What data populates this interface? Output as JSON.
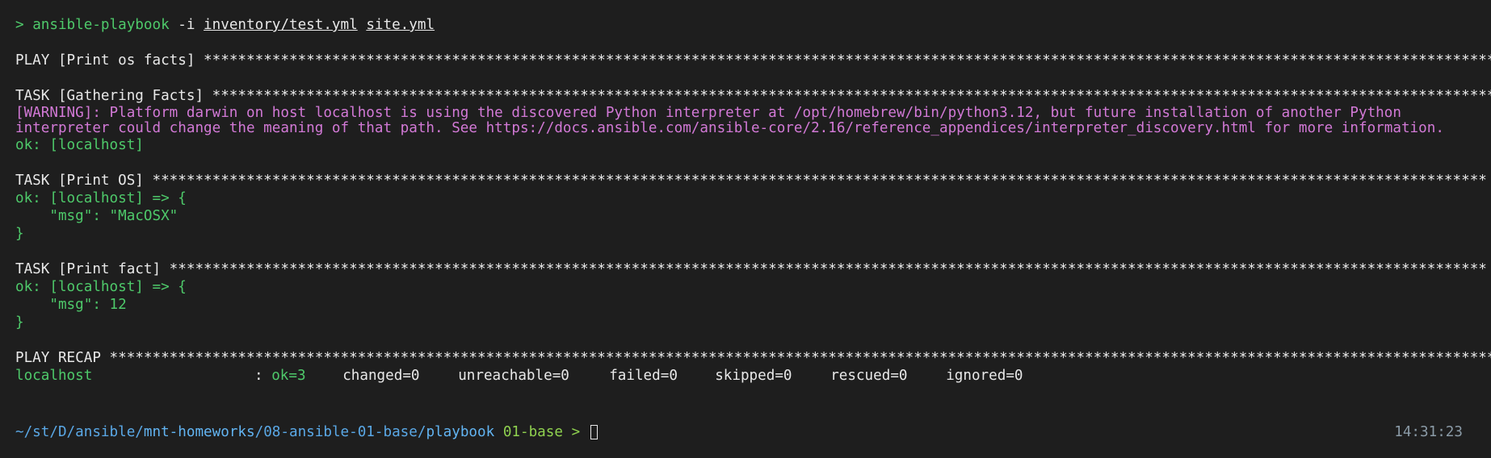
{
  "command": {
    "prompt_symbol": ">",
    "program": "ansible-playbook",
    "flag": "-i",
    "inventory": "inventory/test.yml",
    "playbook": "site.yml"
  },
  "play": {
    "header": "PLAY [Print os facts] ",
    "stars": "**********************************************************************************************************************************************************"
  },
  "tasks": [
    {
      "header": "TASK [Gathering Facts] ",
      "stars": "*******************************************************************************************************************************************************",
      "warning": "[WARNING]: Platform darwin on host localhost is using the discovered Python interpreter at /opt/homebrew/bin/python3.12, but future installation of another Python interpreter could change the meaning of that path. See https://docs.ansible.com/ansible-core/2.16/reference_appendices/interpreter_discovery.html for more information.",
      "result": "ok: [localhost]"
    },
    {
      "header": "TASK [Print OS] ",
      "stars": "************************************************************************************************************************************************************",
      "result_lines": [
        "ok: [localhost] => {",
        "    \"msg\": \"MacOSX\"",
        "}"
      ]
    },
    {
      "header": "TASK [Print fact] ",
      "stars": "**********************************************************************************************************************************************************",
      "result_lines": [
        "ok: [localhost] => {",
        "    \"msg\": 12",
        "}"
      ]
    }
  ],
  "recap": {
    "header": "PLAY RECAP ",
    "stars": "*********************************************************************************************************************************************************************",
    "host": "localhost",
    "separator": ": ",
    "ok": "ok=3",
    "changed": "changed=0",
    "unreachable": "unreachable=0",
    "failed": "failed=0",
    "skipped": "skipped=0",
    "rescued": "rescued=0",
    "ignored": "ignored=0"
  },
  "shell_prompt": {
    "path_home": "~/st/D/",
    "path_ansible": "ansible/",
    "path_repo": "mnt-homeworks",
    "path_sep": "/",
    "path_dir": "08-ansible-01-base/",
    "path_leaf": "playbook",
    "branch": "01-base",
    "arrow": ">",
    "time": "14:31:23"
  }
}
